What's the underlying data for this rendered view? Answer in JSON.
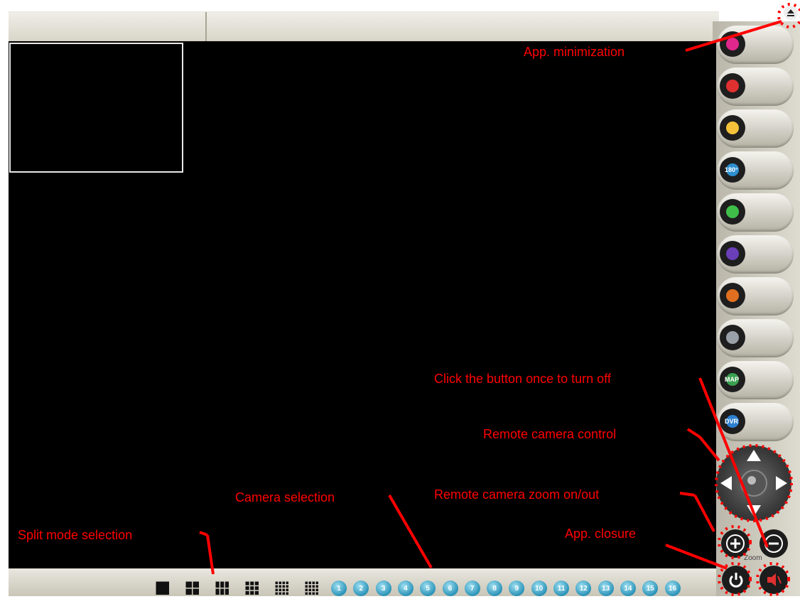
{
  "annotations": {
    "minimize": "App. minimization",
    "turn_off": "Click the button once to turn off",
    "remote_control": "Remote camera control",
    "zoom": "Remote camera zoom on/out",
    "closure": "App. closure",
    "camera_selection": "Camera selection",
    "split_mode": "Split mode selection"
  },
  "side_buttons": [
    {
      "icon": "play-icon",
      "color": "#e0288c"
    },
    {
      "icon": "record-camera-icon",
      "color": "#e03030"
    },
    {
      "icon": "snapshot-icon",
      "color": "#f3c23a"
    },
    {
      "icon": "rotate-180-icon",
      "color": "#2d8fd0",
      "label": "180°"
    },
    {
      "icon": "fullscreen-monitor-icon",
      "color": "#3fbf4a"
    },
    {
      "icon": "lock-icon",
      "color": "#6a3fb8"
    },
    {
      "icon": "camera-settings-icon",
      "color": "#e07020"
    },
    {
      "icon": "tools-icon",
      "color": "#9aa0a8"
    },
    {
      "icon": "map-icon",
      "color": "#3aa050",
      "label": "MAP"
    },
    {
      "icon": "dvr-icon",
      "color": "#2d7fd0",
      "label": "DVR"
    }
  ],
  "zoom_label": "Zoom",
  "split_modes": [
    "1",
    "4",
    "6",
    "9",
    "13",
    "16"
  ],
  "cameras": [
    "1",
    "2",
    "3",
    "4",
    "5",
    "6",
    "7",
    "8",
    "9",
    "10",
    "11",
    "12",
    "13",
    "14",
    "15",
    "16"
  ]
}
